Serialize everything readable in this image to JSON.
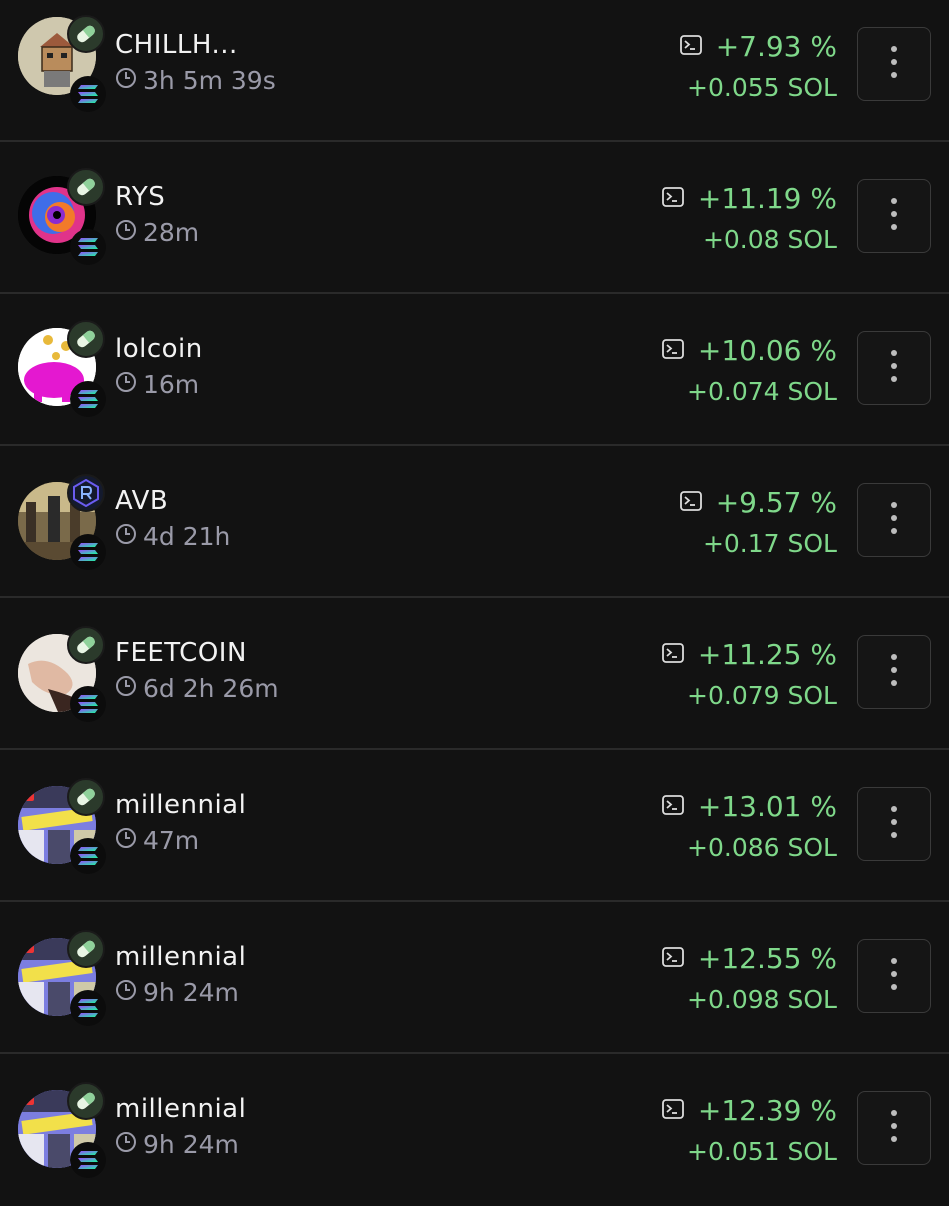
{
  "colors": {
    "background": "#121212",
    "positive": "#7fd88a",
    "muted": "#9a9aa8",
    "divider": "#2a2a2a"
  },
  "rows": [
    {
      "name": "CHILLH...",
      "age": "3h 5m 39s",
      "percent": "+7.93 %",
      "sol": "+0.055 SOL",
      "top_badge": "pill-icon",
      "avatar": "house-character-avatar"
    },
    {
      "name": "RYS",
      "age": "28m",
      "percent": "+11.19 %",
      "sol": "+0.08 SOL",
      "top_badge": "pill-icon",
      "avatar": "swirl-avatar"
    },
    {
      "name": "lolcoin",
      "age": "16m",
      "percent": "+10.06 %",
      "sol": "+0.074 SOL",
      "top_badge": "pill-icon",
      "avatar": "piggy-bank-avatar"
    },
    {
      "name": "AVB",
      "age": "4d 21h",
      "percent": "+9.57 %",
      "sol": "+0.17 SOL",
      "top_badge": "raydium-icon",
      "avatar": "scene-avatar"
    },
    {
      "name": "FEETCOIN",
      "age": "6d 2h 26m",
      "percent": "+11.25 %",
      "sol": "+0.079 SOL",
      "top_badge": "pill-icon",
      "avatar": "feet-avatar"
    },
    {
      "name": "millennial",
      "age": "47m",
      "percent": "+13.01 %",
      "sol": "+0.086 SOL",
      "top_badge": "pill-icon",
      "avatar": "millennial-avatar"
    },
    {
      "name": "millennial",
      "age": "9h 24m",
      "percent": "+12.55 %",
      "sol": "+0.098 SOL",
      "top_badge": "pill-icon",
      "avatar": "millennial-avatar"
    },
    {
      "name": "millennial",
      "age": "9h 24m",
      "percent": "+12.39 %",
      "sol": "+0.051 SOL",
      "top_badge": "pill-icon",
      "avatar": "millennial-avatar"
    }
  ]
}
